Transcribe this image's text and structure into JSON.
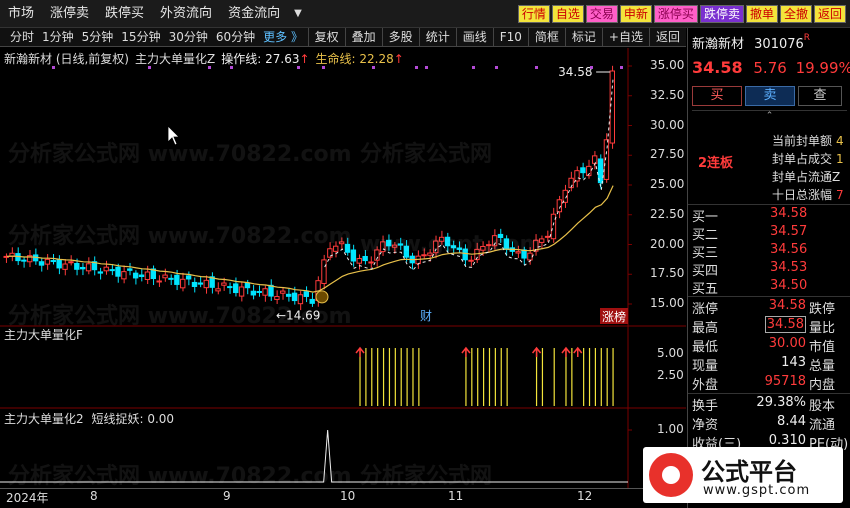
{
  "menu": [
    "市场",
    "涨停卖",
    "跌停买",
    "外资流向",
    "资金流向"
  ],
  "quick_buttons": [
    {
      "label": "行情",
      "style": "yellow"
    },
    {
      "label": "自选",
      "style": "yellow"
    },
    {
      "label": "交易",
      "style": "pink"
    },
    {
      "label": "申新",
      "style": "yellow"
    },
    {
      "label": "涨停买",
      "style": "pink"
    },
    {
      "label": "跌停卖",
      "style": "purple"
    },
    {
      "label": "撤单",
      "style": "yellow"
    },
    {
      "label": "全撤",
      "style": "yellow"
    },
    {
      "label": "返回",
      "style": "yellow"
    }
  ],
  "toolbar": {
    "periods": [
      "分时",
      "1分钟",
      "5分钟",
      "15分钟",
      "30分钟",
      "60分钟"
    ],
    "more": "更多 》",
    "right": [
      "复权",
      "叠加",
      "多股",
      "统计",
      "画线",
      "F10",
      "简框",
      "标记",
      "+自选",
      "返回"
    ]
  },
  "legend": {
    "stock": "新瀚新材 (日线,前复权)",
    "indicator": "主力大单量化Z",
    "op_label": "操作线:",
    "op_value": "27.63",
    "life_label": "生命线:",
    "life_value": "22.28"
  },
  "price_axis": [
    "35.00",
    "32.50",
    "30.00",
    "27.50",
    "25.00",
    "22.50",
    "20.00",
    "17.50",
    "15.00"
  ],
  "markers": {
    "high": "34.58",
    "low": "14.69",
    "fin": "财",
    "zhang": "涨榜"
  },
  "sub1": {
    "title": "主力大单量化F",
    "ticks": [
      "5.00",
      "2.50"
    ]
  },
  "sub2": {
    "title": "主力大单量化2",
    "line_label": "短线捉妖:",
    "line_value": "0.00",
    "ticks": [
      "1.00"
    ]
  },
  "xaxis": [
    "2024年",
    "8",
    "9",
    "10",
    "11",
    "12"
  ],
  "right_panel": {
    "name": "新瀚新材",
    "code": "301076",
    "r": "R",
    "price": "34.58",
    "change": "5.76",
    "pct": "19.99%",
    "buy": "买",
    "sell": "卖",
    "check": "查",
    "lianban": "2连板",
    "seal": [
      {
        "label": "当前封单额",
        "value": "4"
      },
      {
        "label": "封单占成交",
        "value": "1"
      },
      {
        "label": "封单占流通Z",
        "value": ""
      },
      {
        "label": "十日总涨幅",
        "value": "7"
      }
    ],
    "orders": [
      {
        "label": "买一",
        "value": "34.58"
      },
      {
        "label": "买二",
        "value": "34.57"
      },
      {
        "label": "买三",
        "value": "34.56"
      },
      {
        "label": "买四",
        "value": "34.53"
      },
      {
        "label": "买五",
        "value": "34.50"
      }
    ],
    "stats": [
      {
        "l1": "涨停",
        "v1": "34.58",
        "c": "red",
        "l2": "跌停",
        "boxed": false
      },
      {
        "l1": "最高",
        "v1": "34.58",
        "c": "red",
        "l2": "量比",
        "boxed": true
      },
      {
        "l1": "最低",
        "v1": "30.00",
        "c": "red",
        "l2": "市值",
        "boxed": false
      },
      {
        "l1": "现量",
        "v1": "143",
        "c": "wht",
        "l2": "总量",
        "boxed": false
      },
      {
        "l1": "外盘",
        "v1": "95718",
        "c": "red",
        "l2": "内盘",
        "boxed": false
      },
      {
        "l1": "换手",
        "v1": "29.38%",
        "c": "wht",
        "l2": "股本",
        "boxed": false
      },
      {
        "l1": "净资",
        "v1": "8.44",
        "c": "wht",
        "l2": "流通",
        "boxed": false
      },
      {
        "l1": "收益(三)",
        "v1": "0.310",
        "c": "wht",
        "l2": "PE(动)",
        "boxed": false
      }
    ]
  },
  "watermark": {
    "text1": "分析家公式网",
    "url1": "www.70822.com",
    "url2": "www.gspt.com"
  },
  "logo": {
    "title": "公式平台",
    "url": "www.gspt.com"
  },
  "colors": {
    "up": "#ff3b3b",
    "down": "#00e5ff",
    "life_line": "#e8c04a",
    "signal": "#f3e43b"
  }
}
